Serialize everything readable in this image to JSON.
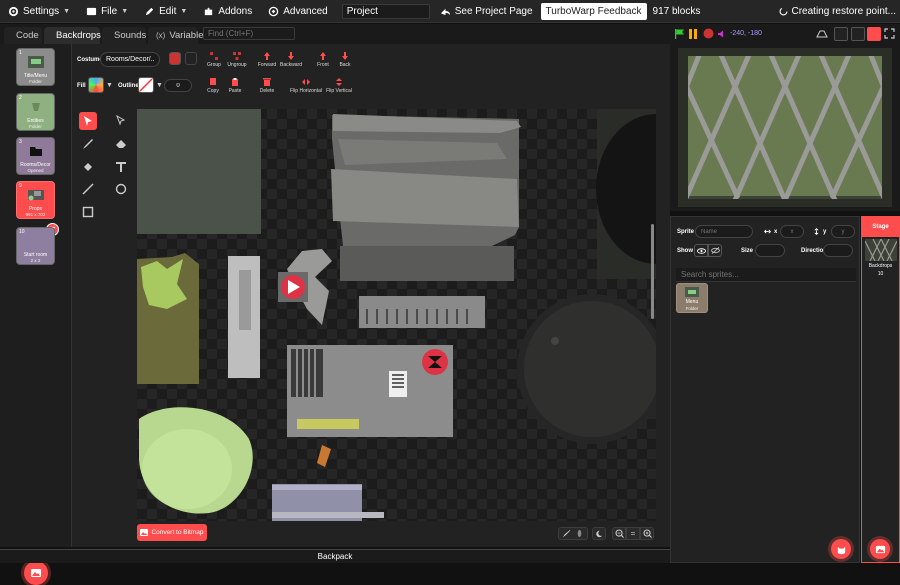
{
  "menubar": {
    "settings_label": "Settings",
    "file_label": "File",
    "edit_label": "Edit",
    "addons_label": "Addons",
    "advanced_label": "Advanced",
    "project_title": "Project",
    "see_project_label": "See Project Page",
    "feedback_label": "TurboWarp Feedback",
    "blocks_count": "917 blocks",
    "restore_status": "Creating restore point..."
  },
  "tabs": {
    "code": "Code",
    "backdrops": "Backdrops",
    "sounds": "Sounds",
    "variables": "Variables",
    "find_placeholder": "Find (Ctrl+F)"
  },
  "stage_controls": {
    "mouse_coords": "-240, -180"
  },
  "costumes": [
    {
      "num": "1",
      "name": "Title/Menu",
      "info": "Folder"
    },
    {
      "num": "2",
      "name": "Entities",
      "info": "Folder"
    },
    {
      "num": "3",
      "name": "Rooms/Decor",
      "info": "Opened"
    },
    {
      "num": "9",
      "name": "Props",
      "info": "961 x 702"
    },
    {
      "num": "10",
      "name": "Start room",
      "info": "2 x 2"
    }
  ],
  "paint": {
    "costume_label": "Costume",
    "costume_name": "Rooms/Decor/...",
    "group": "Group",
    "ungroup": "Ungroup",
    "forward": "Forward",
    "backward": "Backward",
    "front": "Front",
    "back": "Back",
    "copy": "Copy",
    "paste": "Paste",
    "delete": "Delete",
    "flip_h": "Flip Horizontal",
    "flip_v": "Flip Vertical",
    "fill_label": "Fill",
    "outline_label": "Outline",
    "outline_width": "0",
    "convert_label": "Convert to Bitmap",
    "zoom_reset": "="
  },
  "backpack_label": "Backpack",
  "sprite_panel": {
    "sprite_label": "Sprite",
    "name_placeholder": "Name",
    "x_label": "x",
    "x_placeholder": "x",
    "y_label": "y",
    "y_placeholder": "y",
    "show_label": "Show",
    "size_label": "Size",
    "direction_label": "Direction",
    "search_placeholder": "Search sprites...",
    "sprites": [
      {
        "name": "Menu",
        "info": "Folder"
      }
    ]
  },
  "stage_panel": {
    "title": "Stage",
    "backdrops_label": "Backdrops",
    "backdrops_count": "10"
  },
  "colors": {
    "accent": "#ff4c4c",
    "background": "#222222",
    "menubar": "#262626"
  }
}
